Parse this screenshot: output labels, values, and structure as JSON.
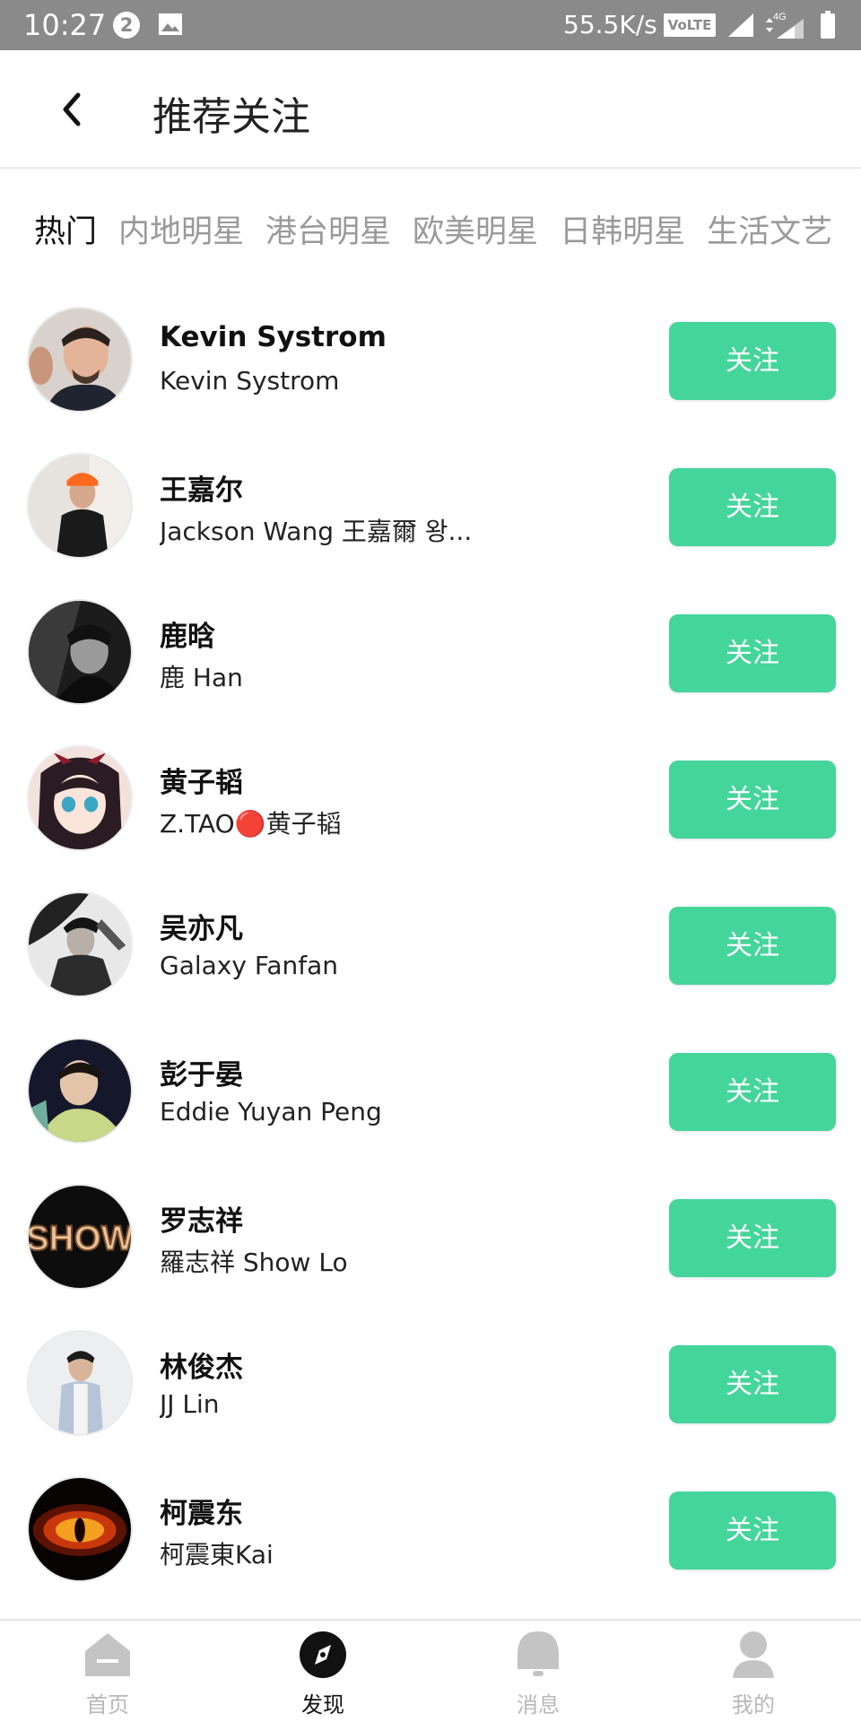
{
  "status_bar": {
    "time": "10:27",
    "notification_count": "2",
    "net_speed": "55.5K/s",
    "volte": "VoLTE",
    "network": "4G"
  },
  "header": {
    "title": "推荐关注"
  },
  "tabs": [
    {
      "label": "热门",
      "active": true
    },
    {
      "label": "内地明星",
      "active": false
    },
    {
      "label": "港台明星",
      "active": false
    },
    {
      "label": "欧美明星",
      "active": false
    },
    {
      "label": "日韩明星",
      "active": false
    },
    {
      "label": "生活文艺",
      "active": false
    }
  ],
  "follow_label": "关注",
  "users": [
    {
      "name": "Kevin Systrom",
      "subtitle": "Kevin Systrom"
    },
    {
      "name": "王嘉尔",
      "subtitle": "Jackson Wang 王嘉爾 왕..."
    },
    {
      "name": "鹿晗",
      "subtitle": "鹿 Han"
    },
    {
      "name": "黄子韬",
      "subtitle": "Z.TAO🔴黄子韬"
    },
    {
      "name": "吴亦凡",
      "subtitle": "Galaxy Fanfan"
    },
    {
      "name": "彭于晏",
      "subtitle": "Eddie Yuyan Peng"
    },
    {
      "name": "罗志祥",
      "subtitle": "羅志祥 Show Lo"
    },
    {
      "name": "林俊杰",
      "subtitle": "JJ Lin"
    },
    {
      "name": "柯震东",
      "subtitle": "柯震東Kai"
    }
  ],
  "avatar_show_text": "SHOW",
  "bottom_nav": [
    {
      "label": "首页",
      "icon": "home-icon",
      "active": false
    },
    {
      "label": "发现",
      "icon": "compass-icon",
      "active": true
    },
    {
      "label": "消息",
      "icon": "bell-icon",
      "active": false
    },
    {
      "label": "我的",
      "icon": "person-icon",
      "active": false
    }
  ],
  "colors": {
    "accent": "#44d59a",
    "status_bar": "#8a8a8a",
    "tab_inactive": "#9a9a9a",
    "nav_inactive": "#b8b8b8"
  }
}
